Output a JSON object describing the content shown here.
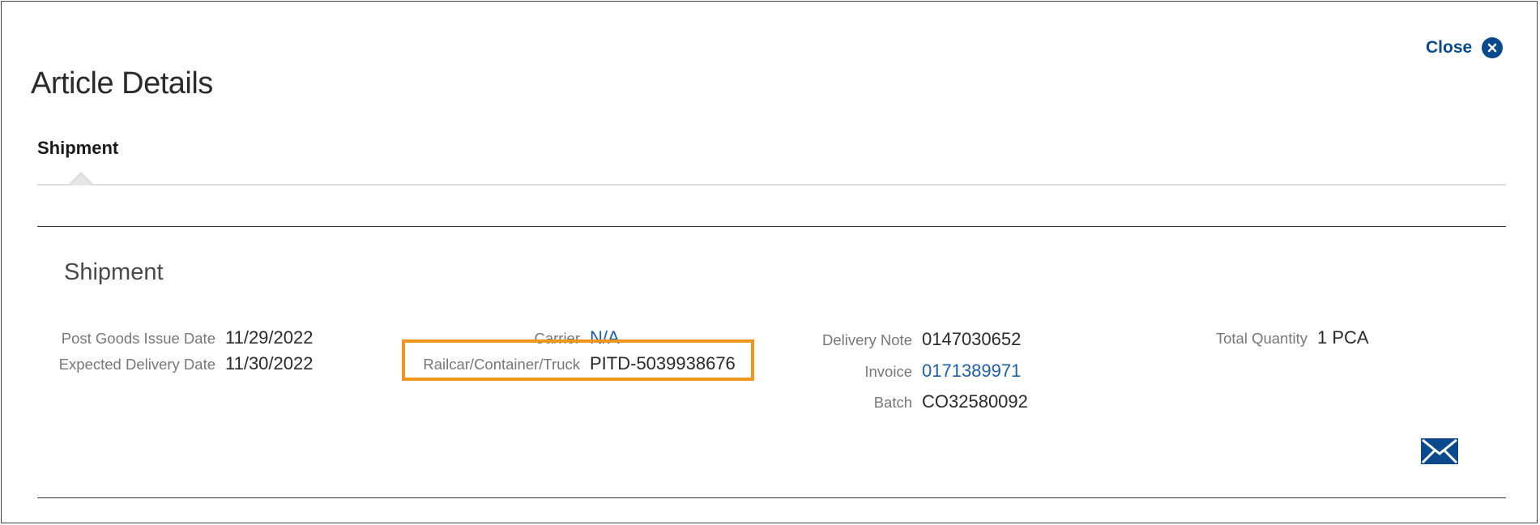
{
  "header": {
    "title": "Article Details",
    "close_label": "Close"
  },
  "tabs": [
    {
      "label": "Shipment",
      "active": true
    }
  ],
  "section": {
    "title": "Shipment",
    "fields": {
      "post_goods_issue_date": {
        "label": "Post Goods Issue Date",
        "value": "11/29/2022"
      },
      "expected_delivery_date": {
        "label": "Expected Delivery Date",
        "value": "11/30/2022"
      },
      "carrier": {
        "label": "Carrier",
        "value": "N/A"
      },
      "railcar": {
        "label": "Railcar/Container/Truck",
        "value": "PITD-5039938676"
      },
      "delivery_note": {
        "label": "Delivery Note",
        "value": "0147030652"
      },
      "invoice": {
        "label": "Invoice",
        "value": "0171389971"
      },
      "batch": {
        "label": "Batch",
        "value": "CO32580092"
      },
      "total_quantity": {
        "label": "Total Quantity",
        "value": "1 PCA"
      }
    }
  },
  "icons": {
    "close": "close-circle-icon",
    "mail": "envelope-icon"
  },
  "colors": {
    "accent": "#0a4a8c",
    "link": "#1f5fa8",
    "highlight": "#f0961e"
  }
}
